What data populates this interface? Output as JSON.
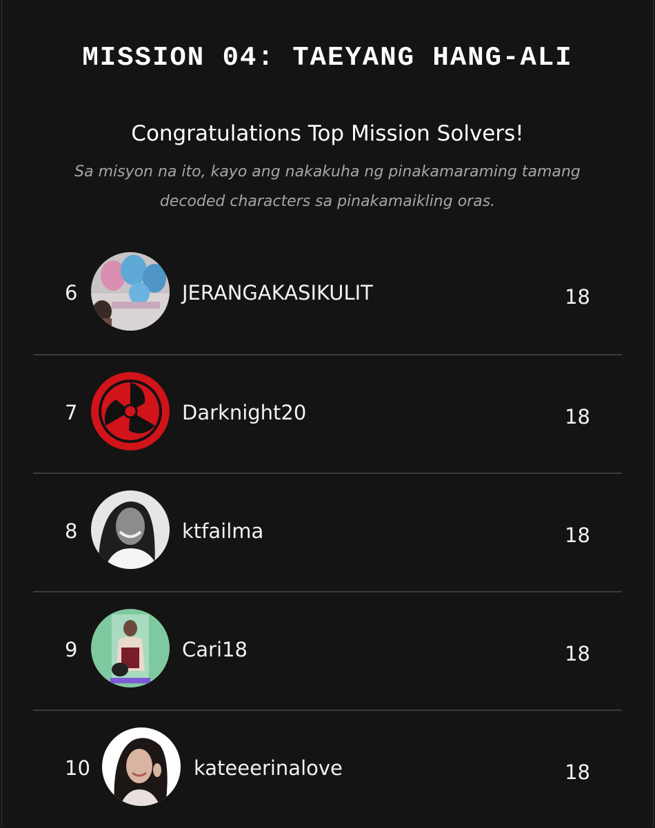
{
  "mission_title": "MISSION 04: TAEYANG HANG-ALI",
  "subtitle": "Congratulations Top Mission Solvers!",
  "description": "Sa misyon na ito, kayo ang nakakuha ng pinakamaraming tamang decoded characters sa pinakamaikling oras.",
  "leaderboard": [
    {
      "rank": "6",
      "username": "JERANGAKASIKULIT",
      "score": "18",
      "avatar": "balloons-photo-avatar"
    },
    {
      "rank": "7",
      "username": "Darknight20",
      "score": "18",
      "avatar": "sharingan-avatar"
    },
    {
      "rank": "8",
      "username": "ktfailma",
      "score": "18",
      "avatar": "grayscale-portrait-avatar"
    },
    {
      "rank": "9",
      "username": "Cari18",
      "score": "18",
      "avatar": "green-portrait-avatar"
    },
    {
      "rank": "10",
      "username": "kateeerinalove",
      "score": "18",
      "avatar": "selfie-portrait-avatar"
    }
  ],
  "colors": {
    "background": "#141414",
    "text": "#f2f2f2",
    "muted": "#a6a6a6",
    "divider": "#3c3c3c"
  }
}
